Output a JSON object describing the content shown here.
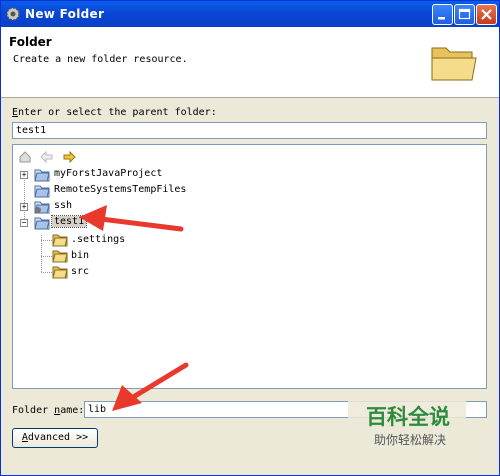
{
  "window": {
    "title": "New Folder"
  },
  "header": {
    "title": "Folder",
    "description": "Create a new folder resource."
  },
  "parent": {
    "label": "Enter or select the parent folder:",
    "value": "test1"
  },
  "tree": {
    "items": [
      {
        "label": "myForstJavaProject"
      },
      {
        "label": "RemoteSystemsTempFiles"
      },
      {
        "label": "ssh"
      },
      {
        "label": "test1"
      }
    ],
    "children": [
      {
        "label": ".settings"
      },
      {
        "label": "bin"
      },
      {
        "label": "src"
      }
    ]
  },
  "folder_name": {
    "label": "Folder name:",
    "value": "lib"
  },
  "advanced": {
    "label": "Advanced >>"
  },
  "watermark": {
    "title": "百科全说",
    "subtitle": "助你轻松解决"
  },
  "colors": {
    "titlebar": "#0a47d6",
    "arrow": "#e8392c",
    "watermark": "#2e8b3e"
  },
  "icons": [
    "gear-icon",
    "minimize-icon",
    "maximize-icon",
    "close-icon",
    "folder-large-icon",
    "home-icon",
    "back-icon",
    "forward-icon",
    "project-icon",
    "folder-icon"
  ]
}
